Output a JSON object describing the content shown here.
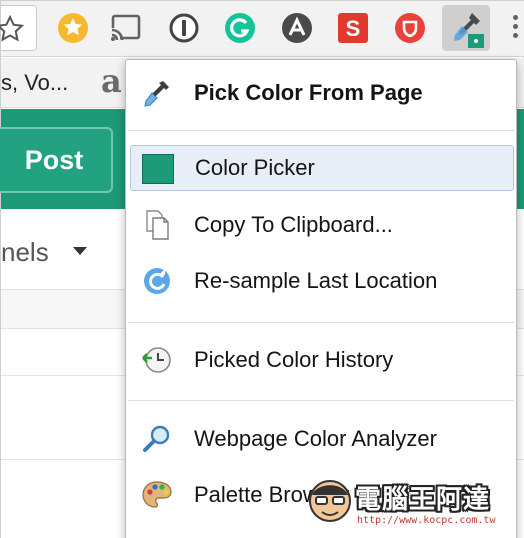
{
  "toolbar": {
    "extensions": [
      {
        "name": "bookmark-star-icon"
      },
      {
        "name": "starred-extension-icon",
        "color": "#f5b82e"
      },
      {
        "name": "cast-icon"
      },
      {
        "name": "onepassword-icon"
      },
      {
        "name": "grammarly-icon",
        "color": "#15c39a"
      },
      {
        "name": "adblock-icon"
      },
      {
        "name": "scribd-icon",
        "color": "#e03a2f",
        "letter": "S"
      },
      {
        "name": "shield-icon",
        "color": "#e8423b"
      },
      {
        "name": "color-picker-extension-icon",
        "color": "#1d9a78",
        "active": true
      }
    ]
  },
  "bookmarks": {
    "partial_text": "s, Vo...",
    "amazon_letter": "a"
  },
  "page": {
    "post_label": "Post",
    "channels_text": "nels",
    "accent_color": "#1d9a78"
  },
  "menu": {
    "items": [
      {
        "label": "Pick Color From Page",
        "icon": "eyedropper-icon",
        "bold": true
      },
      {
        "label": "Color Picker",
        "icon": "color-swatch-icon",
        "selected": true,
        "swatch_color": "#1d9a78"
      },
      {
        "label": "Copy To Clipboard...",
        "icon": "copy-document-icon"
      },
      {
        "label": "Re-sample Last Location",
        "icon": "refresh-icon"
      },
      {
        "label": "Picked Color History",
        "icon": "history-clock-icon"
      },
      {
        "label": "Webpage Color Analyzer",
        "icon": "magnifier-icon"
      },
      {
        "label": "Palette Browser",
        "icon": "palette-icon"
      }
    ]
  },
  "watermark": {
    "title": "電腦王阿達",
    "url": "http://www.kocpc.com.tw"
  }
}
